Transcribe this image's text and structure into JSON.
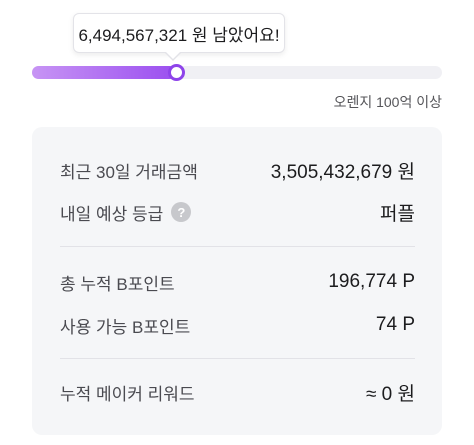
{
  "tooltip": {
    "text": "6,494,567,321 원 남았어요!"
  },
  "progress": {
    "fraction": 0.35,
    "target_label": "오렌지 100억 이상",
    "fill_start_color": "#c794f4",
    "fill_end_color": "#9b4ff0",
    "track_color": "#f0f0f4"
  },
  "stats": {
    "trade_volume": {
      "label": "최근 30일 거래금액",
      "value": "3,505,432,679 원"
    },
    "next_grade": {
      "label": "내일 예상 등급",
      "value": "퍼플",
      "help_icon": "question-icon"
    },
    "total_points": {
      "label": "총 누적 B포인트",
      "value": "196,774 P"
    },
    "available_points": {
      "label": "사용 가능 B포인트",
      "value": "74 P"
    },
    "maker_reward": {
      "label": "누적 메이커 리워드",
      "value": "≈ 0 원"
    }
  }
}
